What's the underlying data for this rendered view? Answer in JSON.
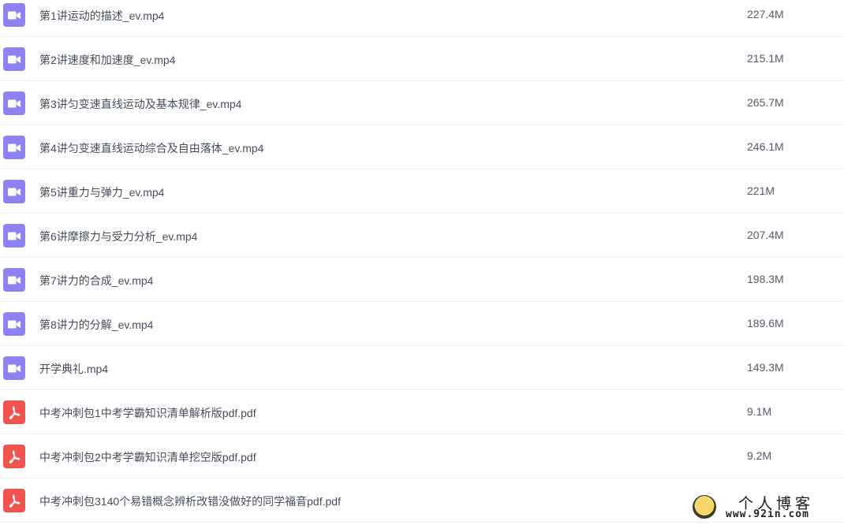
{
  "files": [
    {
      "type": "video",
      "icon": "video-file-icon",
      "name": "第1讲运动的描述_ev.mp4",
      "size": "227.4M"
    },
    {
      "type": "video",
      "icon": "video-file-icon",
      "name": "第2讲速度和加速度_ev.mp4",
      "size": "215.1M"
    },
    {
      "type": "video",
      "icon": "video-file-icon",
      "name": "第3讲匀变速直线运动及基本规律_ev.mp4",
      "size": "265.7M"
    },
    {
      "type": "video",
      "icon": "video-file-icon",
      "name": "第4讲匀变速直线运动综合及自由落体_ev.mp4",
      "size": "246.1M"
    },
    {
      "type": "video",
      "icon": "video-file-icon",
      "name": "第5讲重力与弹力_ev.mp4",
      "size": "221M"
    },
    {
      "type": "video",
      "icon": "video-file-icon",
      "name": "第6讲摩擦力与受力分析_ev.mp4",
      "size": "207.4M"
    },
    {
      "type": "video",
      "icon": "video-file-icon",
      "name": "第7讲力的合成_ev.mp4",
      "size": "198.3M"
    },
    {
      "type": "video",
      "icon": "video-file-icon",
      "name": "第8讲力的分解_ev.mp4",
      "size": "189.6M"
    },
    {
      "type": "video",
      "icon": "video-file-icon",
      "name": "开学典礼.mp4",
      "size": "149.3M"
    },
    {
      "type": "pdf",
      "icon": "pdf-file-icon",
      "name": "中考冲刺包1中考学霸知识清单解析版pdf.pdf",
      "size": "9.1M"
    },
    {
      "type": "pdf",
      "icon": "pdf-file-icon",
      "name": "中考冲刺包2中考学霸知识清单挖空版pdf.pdf",
      "size": "9.2M"
    },
    {
      "type": "pdf",
      "icon": "pdf-file-icon",
      "name": "中考冲刺包3140个易错概念辨析改错没做好的同学福音pdf.pdf",
      "size": ""
    }
  ],
  "watermark": {
    "title": "个人博客",
    "url": "www.92in.com"
  },
  "colors": {
    "video_icon": "#8c82f0",
    "pdf_icon": "#f2534f",
    "text": "#454d5a",
    "divider": "#f0f1f4"
  }
}
